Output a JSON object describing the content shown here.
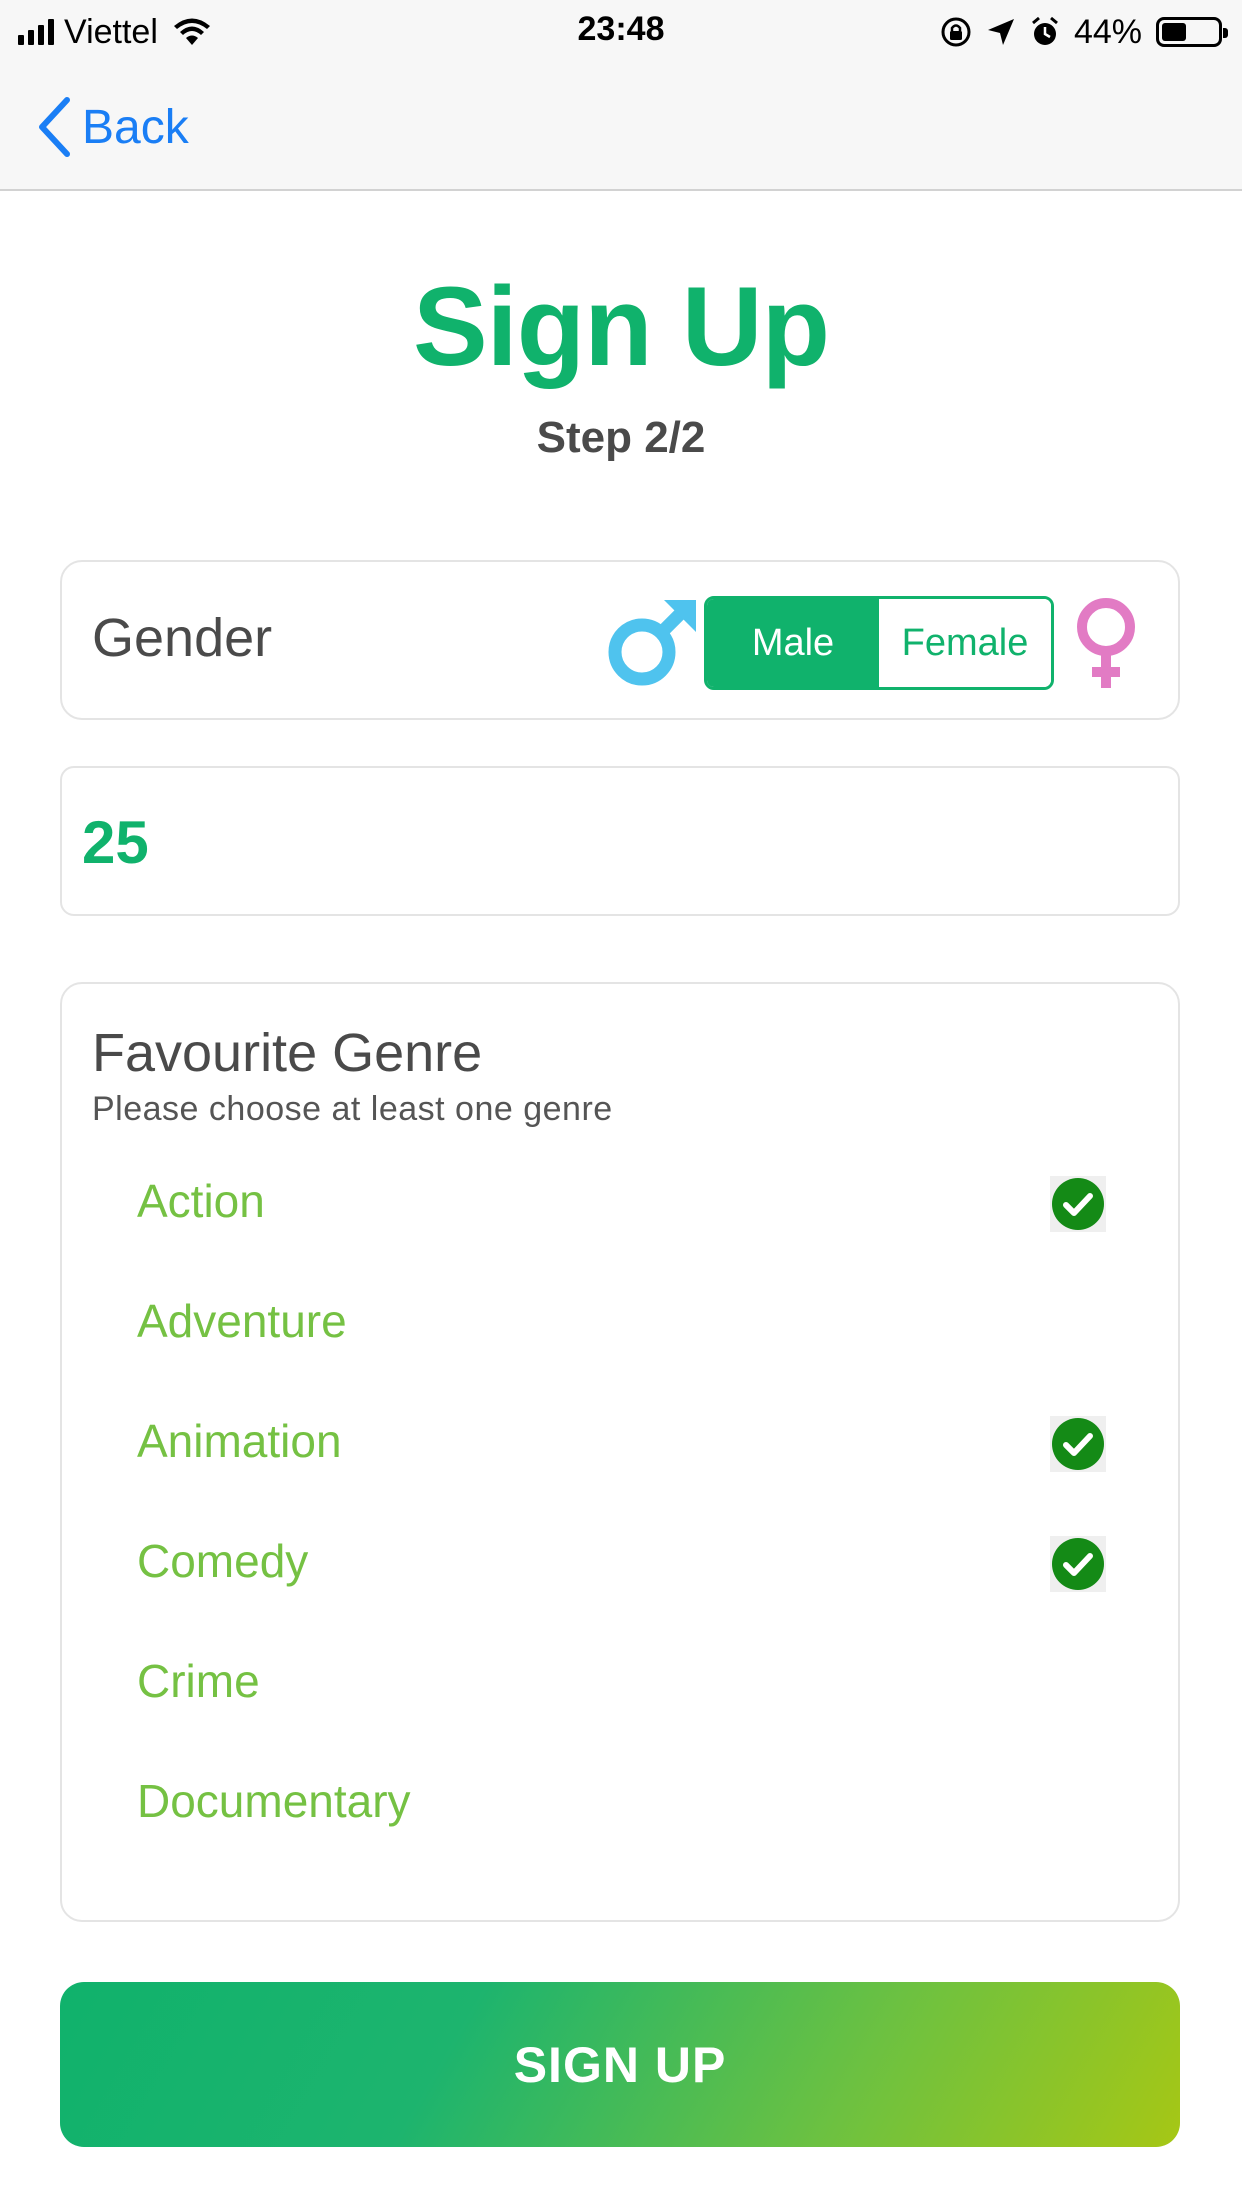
{
  "status_bar": {
    "carrier": "Viettel",
    "time": "23:48",
    "battery_percent": "44%",
    "battery_level": 0.44,
    "icons": [
      "signal-icon",
      "wifi-icon",
      "orientation-lock-icon",
      "location-icon",
      "alarm-icon",
      "battery-icon"
    ]
  },
  "nav": {
    "back_label": "Back",
    "back_icon": "chevron-left-icon"
  },
  "header": {
    "title": "Sign Up",
    "step": "Step 2/2"
  },
  "gender": {
    "label": "Gender",
    "options": [
      "Male",
      "Female"
    ],
    "selected": "Male",
    "male_icon": "male-symbol-icon",
    "female_icon": "female-symbol-icon"
  },
  "age": {
    "value": "25"
  },
  "genre": {
    "title": "Favourite Genre",
    "hint": "Please choose at least one genre",
    "items": [
      {
        "label": "Action",
        "checked": true
      },
      {
        "label": "Adventure",
        "checked": false
      },
      {
        "label": "Animation",
        "checked": true
      },
      {
        "label": "Comedy",
        "checked": true
      },
      {
        "label": "Crime",
        "checked": false
      },
      {
        "label": "Documentary",
        "checked": false
      }
    ]
  },
  "signup_button": {
    "label": "SIGN UP"
  },
  "colors": {
    "brand_green": "#10b26c",
    "genre_text": "#75c143",
    "link_blue": "#1a7ef5",
    "male_blue": "#4fc3ee",
    "female_pink": "#e27bc4",
    "check_green": "#148a16"
  }
}
